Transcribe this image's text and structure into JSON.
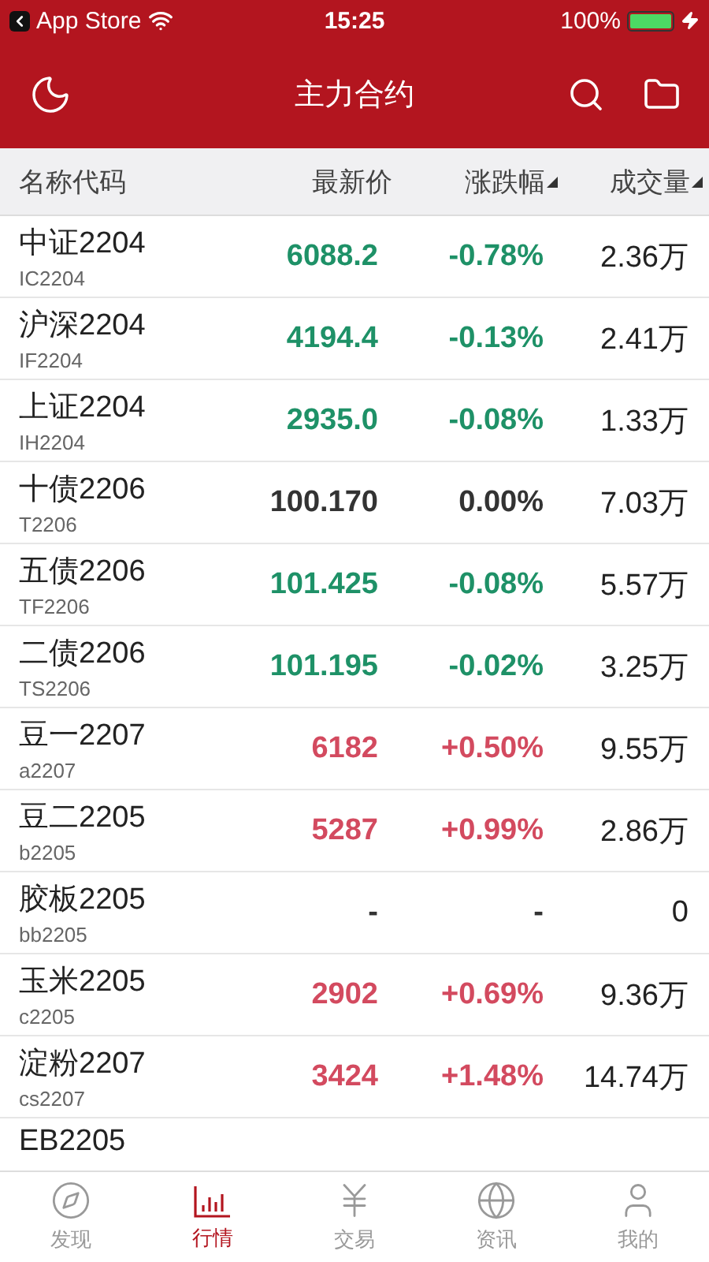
{
  "status_bar": {
    "back_label": "App Store",
    "time": "15:25",
    "battery": "100%"
  },
  "nav": {
    "title": "主力合约"
  },
  "table": {
    "columns": [
      {
        "label": "名称代码",
        "sortable": false
      },
      {
        "label": "最新价",
        "sortable": false
      },
      {
        "label": "涨跌幅",
        "sortable": true
      },
      {
        "label": "成交量",
        "sortable": true
      }
    ],
    "rows": [
      {
        "name": "中证2204",
        "code": "IC2204",
        "price": "6088.2",
        "change": "-0.78%",
        "volume": "2.36万",
        "kind": "down"
      },
      {
        "name": "沪深2204",
        "code": "IF2204",
        "price": "4194.4",
        "change": "-0.13%",
        "volume": "2.41万",
        "kind": "down"
      },
      {
        "name": "上证2204",
        "code": "IH2204",
        "price": "2935.0",
        "change": "-0.08%",
        "volume": "1.33万",
        "kind": "down"
      },
      {
        "name": "十债2206",
        "code": "T2206",
        "price": "100.170",
        "change": "0.00%",
        "volume": "7.03万",
        "kind": "flat"
      },
      {
        "name": "五债2206",
        "code": "TF2206",
        "price": "101.425",
        "change": "-0.08%",
        "volume": "5.57万",
        "kind": "down"
      },
      {
        "name": "二债2206",
        "code": "TS2206",
        "price": "101.195",
        "change": "-0.02%",
        "volume": "3.25万",
        "kind": "down"
      },
      {
        "name": "豆一2207",
        "code": "a2207",
        "price": "6182",
        "change": "+0.50%",
        "volume": "9.55万",
        "kind": "up"
      },
      {
        "name": "豆二2205",
        "code": "b2205",
        "price": "5287",
        "change": "+0.99%",
        "volume": "2.86万",
        "kind": "up"
      },
      {
        "name": "胶板2205",
        "code": "bb2205",
        "price": "-",
        "change": "-",
        "volume": "0",
        "kind": "flat"
      },
      {
        "name": "玉米2205",
        "code": "c2205",
        "price": "2902",
        "change": "+0.69%",
        "volume": "9.36万",
        "kind": "up"
      },
      {
        "name": "淀粉2207",
        "code": "cs2207",
        "price": "3424",
        "change": "+1.48%",
        "volume": "14.74万",
        "kind": "up"
      },
      {
        "name": "EB2205"
      }
    ]
  },
  "tab_bar": [
    {
      "label": "发现",
      "kind": "compass",
      "selected": false
    },
    {
      "label": "行情",
      "kind": "chart",
      "selected": true
    },
    {
      "label": "交易",
      "kind": "yen",
      "selected": false
    },
    {
      "label": "资讯",
      "kind": "planet",
      "selected": false
    },
    {
      "label": "我的",
      "kind": "person",
      "selected": false
    }
  ]
}
